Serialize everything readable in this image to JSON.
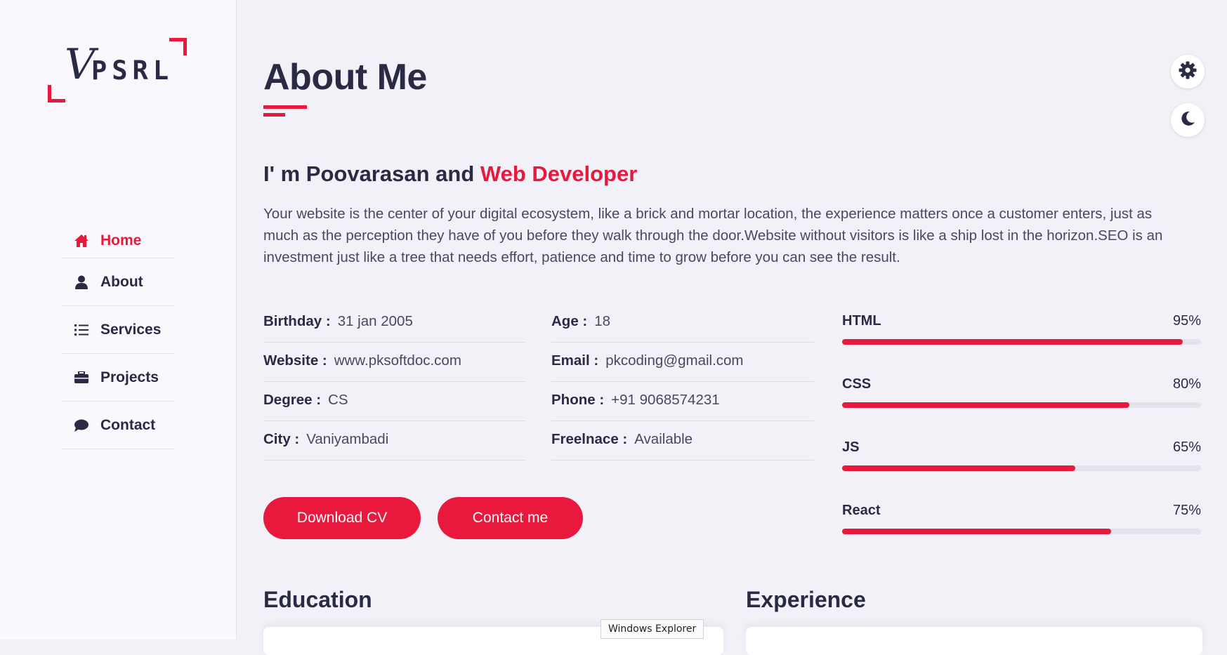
{
  "colors": {
    "accent": "#e8193c",
    "text": "#2b2a45",
    "background": "#f2f1f8"
  },
  "logo": {
    "text": "PSRL",
    "mark": "V"
  },
  "nav": [
    {
      "label": "Home",
      "icon": "home-icon",
      "active": true
    },
    {
      "label": "About",
      "icon": "user-icon",
      "active": false
    },
    {
      "label": "Services",
      "icon": "list-icon",
      "active": false
    },
    {
      "label": "Projects",
      "icon": "briefcase-icon",
      "active": false
    },
    {
      "label": "Contact",
      "icon": "chat-bubble-icon",
      "active": false
    }
  ],
  "page": {
    "title": "About Me"
  },
  "intro": {
    "prefix": "I' m Poovarasan and ",
    "role": "Web Developer"
  },
  "description": "Your website is the center of your digital ecosystem, like a brick and mortar location, the experience matters once a customer enters, just as much as the perception they have of you before they walk through the door.Website without visitors is like a ship lost in the horizon.SEO is an investment just like a tree that needs effort, patience and time to grow before you can see the result.",
  "info": {
    "left": [
      {
        "label": "Birthday :",
        "value": "31 jan 2005"
      },
      {
        "label": "Website :",
        "value": "www.pksoftdoc.com"
      },
      {
        "label": "Degree :",
        "value": "CS"
      },
      {
        "label": "City :",
        "value": "Vaniyambadi"
      }
    ],
    "right": [
      {
        "label": "Age :",
        "value": "18"
      },
      {
        "label": "Email :",
        "value": "pkcoding@gmail.com"
      },
      {
        "label": "Phone :",
        "value": "+91 9068574231"
      },
      {
        "label": "Freelnace :",
        "value": "Available"
      }
    ]
  },
  "buttons": {
    "download": "Download CV",
    "contact": "Contact me"
  },
  "skills": [
    {
      "name": "HTML",
      "percent_label": "95%",
      "percent": 95
    },
    {
      "name": "CSS",
      "percent_label": "80%",
      "percent": 80
    },
    {
      "name": "JS",
      "percent_label": "65%",
      "percent": 65
    },
    {
      "name": "React",
      "percent_label": "75%",
      "percent": 75
    }
  ],
  "sections": {
    "education": "Education",
    "experience": "Experience"
  },
  "tooltip": "Windows Explorer",
  "controls": {
    "settings_icon": "gear-icon",
    "theme_icon": "moon-icon"
  }
}
